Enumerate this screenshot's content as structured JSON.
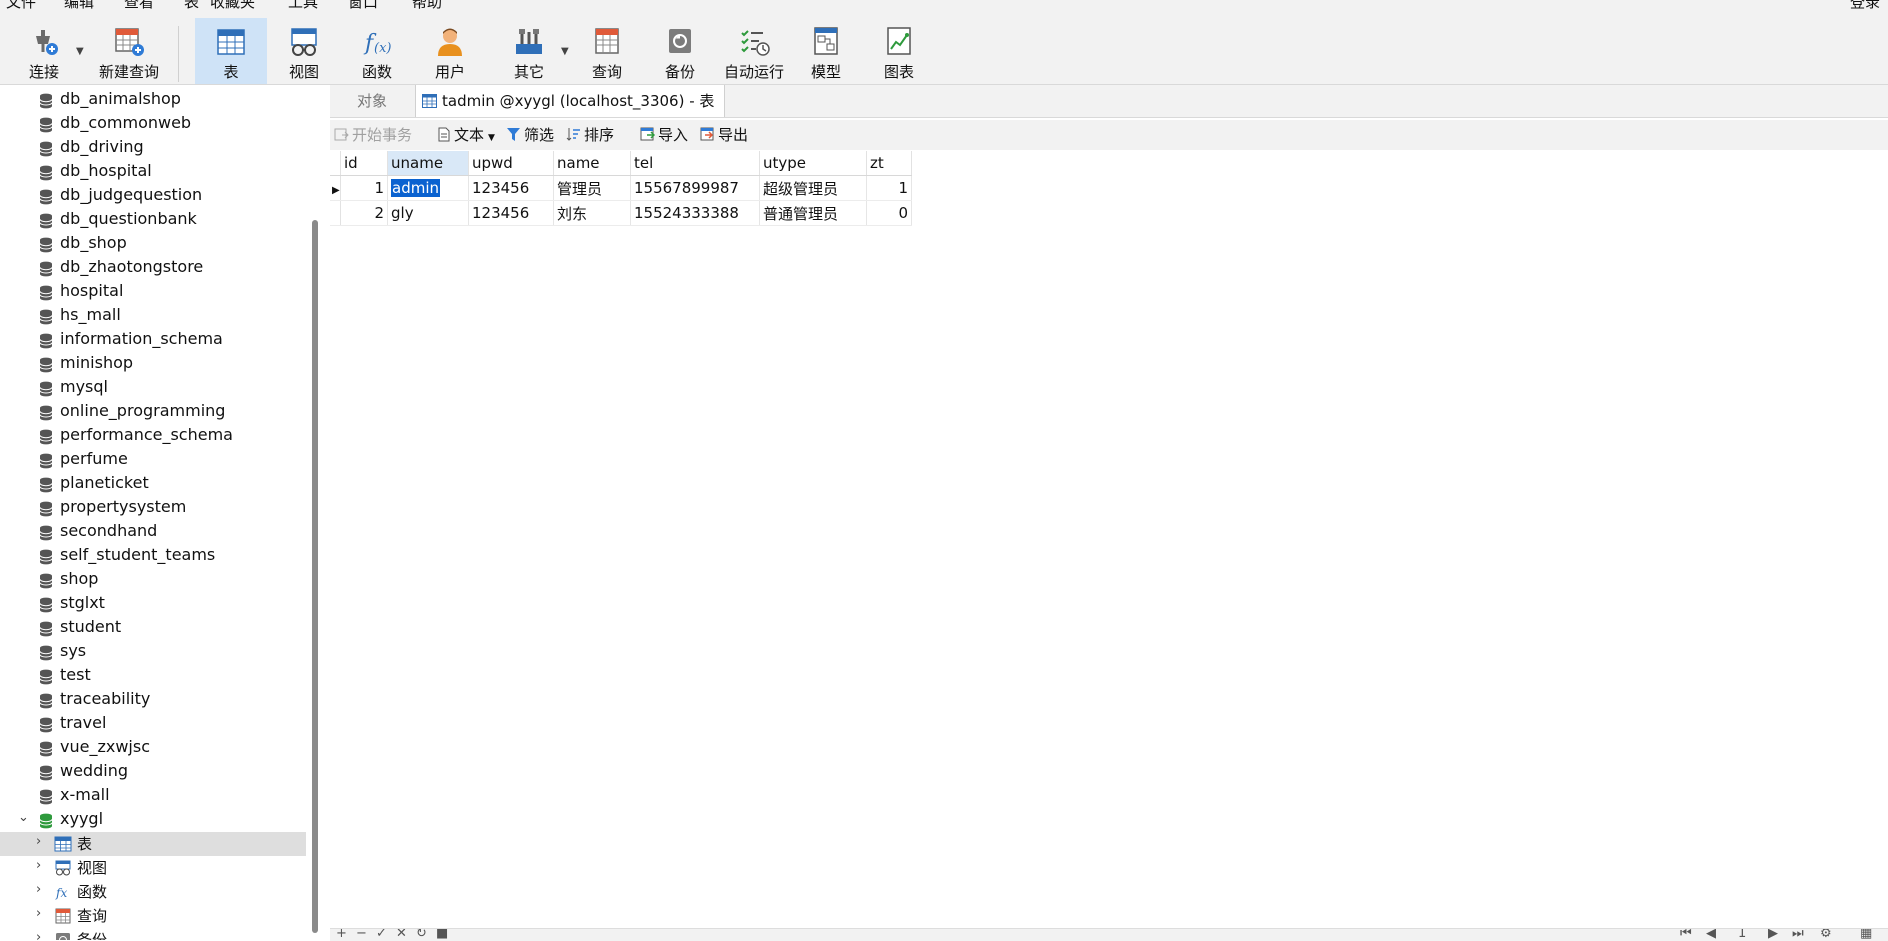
{
  "menu": [
    "文件",
    "编辑",
    "查看",
    "表",
    "收藏夹",
    "工具",
    "窗口",
    "帮助"
  ],
  "login_label": "登录",
  "toolbar": {
    "connect": "连接",
    "new_query": "新建查询",
    "table": "表",
    "view": "视图",
    "function": "函数",
    "user": "用户",
    "other": "其它",
    "query": "查询",
    "backup": "备份",
    "auto_run": "自动运行",
    "model": "模型",
    "chart": "图表"
  },
  "sidebar": {
    "databases": [
      "db_animalshop",
      "db_commonweb",
      "db_driving",
      "db_hospital",
      "db_judgequestion",
      "db_questionbank",
      "db_shop",
      "db_zhaotongstore",
      "hospital",
      "hs_mall",
      "information_schema",
      "minishop",
      "mysql",
      "online_programming",
      "performance_schema",
      "perfume",
      "planeticket",
      "propertysystem",
      "secondhand",
      "self_student_teams",
      "shop",
      "stglxt",
      "student",
      "sys",
      "test",
      "traceability",
      "travel",
      "vue_zxwjsc",
      "wedding",
      "x-mall"
    ],
    "open_db": "xyygl",
    "children": [
      "表",
      "视图",
      "函数",
      "查询",
      "备份"
    ]
  },
  "tabs": {
    "objects": "对象",
    "active": "tadmin @xyygl (localhost_3306) - 表"
  },
  "subtoolbar": {
    "begin_tx": "开始事务",
    "text": "文本",
    "filter": "筛选",
    "sort": "排序",
    "import": "导入",
    "export": "导出"
  },
  "grid": {
    "columns": [
      "id",
      "uname",
      "upwd",
      "name",
      "tel",
      "utype",
      "zt"
    ],
    "rows": [
      [
        "1",
        "admin",
        "123456",
        "管理员",
        "15567899987",
        "超级管理员",
        "1"
      ],
      [
        "2",
        "gly",
        "123456",
        "刘东",
        "15524333388",
        "普通管理员",
        "0"
      ]
    ]
  },
  "statusbar": {
    "page": "1"
  },
  "colors": {
    "toolbar_bg": "#f2f2f2",
    "active_tool_bg": "#cfe3f7",
    "selection": "#0a62d0",
    "db_icon": "#555555",
    "open_db_icon": "#2e9a3c"
  }
}
